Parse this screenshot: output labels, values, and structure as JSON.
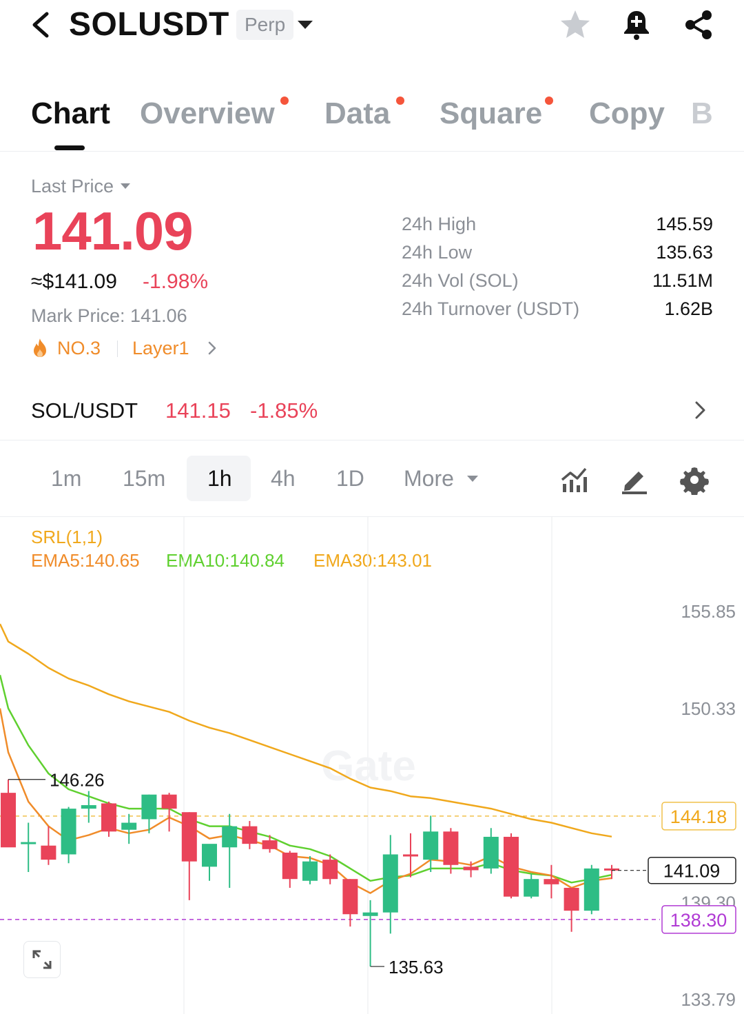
{
  "header": {
    "symbol": "SOLUSDT",
    "contract_type": "Perp",
    "icons": [
      "back-icon",
      "star-icon",
      "bell-plus-icon",
      "share-icon"
    ]
  },
  "tabs": [
    {
      "label": "Chart",
      "active": true,
      "dot": false
    },
    {
      "label": "Overview",
      "active": false,
      "dot": true
    },
    {
      "label": "Data",
      "active": false,
      "dot": true
    },
    {
      "label": "Square",
      "active": false,
      "dot": true
    },
    {
      "label": "Copy",
      "active": false,
      "dot": false
    },
    {
      "label": "B",
      "active": false,
      "dot": false
    }
  ],
  "price": {
    "last_price_label": "Last Price",
    "last_price": "141.09",
    "usd_price": "≈$141.09",
    "change_pct": "-1.98%",
    "mark_price_label": "Mark Price:",
    "mark_price": "141.06",
    "rank": "NO.3",
    "sector": "Layer1"
  },
  "stats": [
    {
      "label": "24h High",
      "value": "145.59"
    },
    {
      "label": "24h Low",
      "value": "135.63"
    },
    {
      "label": "24h Vol (SOL)",
      "value": "11.51M"
    },
    {
      "label": "24h Turnover (USDT)",
      "value": "1.62B"
    }
  ],
  "spot": {
    "pair": "SOL/USDT",
    "price": "141.15",
    "change_pct": "-1.85%"
  },
  "timeframes": {
    "options": [
      "1m",
      "15m",
      "1h",
      "4h",
      "1D"
    ],
    "active": "1h",
    "more_label": "More"
  },
  "indicators": {
    "srl": "SRL(1,1)",
    "ema5": "EMA5:140.65",
    "ema10": "EMA10:140.84",
    "ema30": "EMA30:143.01"
  },
  "colors": {
    "up": "#2ebd85",
    "down": "#e94359",
    "ema5": "#f08c2a",
    "ema10": "#5fd02f",
    "ema30": "#f0a81c",
    "mark_line": "#b03ad4"
  },
  "chart_data": {
    "type": "candlestick",
    "y_axis_labels": [
      "155.85",
      "150.33",
      "144.18",
      "141.09",
      "139.30",
      "138.30",
      "133.79"
    ],
    "current_price_label": "141.09",
    "reference_line_label": "144.18",
    "mark_line_label": "138.30",
    "high_marker": "146.26",
    "low_marker": "135.63",
    "watermark": "Gate",
    "candles": [
      {
        "o": 145.5,
        "h": 146.26,
        "l": 142.8,
        "c": 142.4
      },
      {
        "o": 142.7,
        "h": 143.8,
        "l": 141.0,
        "c": 142.7
      },
      {
        "o": 142.5,
        "h": 143.6,
        "l": 141.4,
        "c": 141.7
      },
      {
        "o": 142.0,
        "h": 144.7,
        "l": 141.5,
        "c": 144.6
      },
      {
        "o": 144.6,
        "h": 145.6,
        "l": 143.8,
        "c": 144.8
      },
      {
        "o": 144.9,
        "h": 145.0,
        "l": 143.0,
        "c": 143.3
      },
      {
        "o": 143.4,
        "h": 144.3,
        "l": 142.6,
        "c": 143.8
      },
      {
        "o": 144.0,
        "h": 145.4,
        "l": 143.2,
        "c": 145.4
      },
      {
        "o": 145.4,
        "h": 145.5,
        "l": 143.3,
        "c": 144.6
      },
      {
        "o": 144.4,
        "h": 144.4,
        "l": 139.4,
        "c": 141.6
      },
      {
        "o": 141.3,
        "h": 142.5,
        "l": 140.5,
        "c": 142.6
      },
      {
        "o": 142.4,
        "h": 144.3,
        "l": 140.1,
        "c": 143.6
      },
      {
        "o": 143.6,
        "h": 143.9,
        "l": 142.3,
        "c": 142.6
      },
      {
        "o": 142.8,
        "h": 143.1,
        "l": 142.1,
        "c": 142.3
      },
      {
        "o": 142.1,
        "h": 142.2,
        "l": 140.1,
        "c": 140.6
      },
      {
        "o": 140.5,
        "h": 141.9,
        "l": 140.3,
        "c": 141.6
      },
      {
        "o": 141.7,
        "h": 142.0,
        "l": 140.3,
        "c": 140.6
      },
      {
        "o": 140.6,
        "h": 140.6,
        "l": 137.9,
        "c": 138.6
      },
      {
        "o": 138.5,
        "h": 139.4,
        "l": 135.63,
        "c": 138.7
      },
      {
        "o": 138.7,
        "h": 143.1,
        "l": 137.5,
        "c": 142.0
      },
      {
        "o": 142.0,
        "h": 143.2,
        "l": 140.7,
        "c": 141.9
      },
      {
        "o": 141.7,
        "h": 144.2,
        "l": 141.0,
        "c": 143.3
      },
      {
        "o": 143.3,
        "h": 143.5,
        "l": 140.9,
        "c": 141.4
      },
      {
        "o": 141.3,
        "h": 141.6,
        "l": 140.7,
        "c": 141.1
      },
      {
        "o": 141.2,
        "h": 143.5,
        "l": 140.9,
        "c": 143.0
      },
      {
        "o": 143.0,
        "h": 143.2,
        "l": 139.5,
        "c": 139.6
      },
      {
        "o": 139.6,
        "h": 140.9,
        "l": 139.5,
        "c": 140.6
      },
      {
        "o": 140.6,
        "h": 141.4,
        "l": 139.5,
        "c": 140.3
      },
      {
        "o": 140.1,
        "h": 140.1,
        "l": 137.6,
        "c": 138.8
      },
      {
        "o": 138.8,
        "h": 141.4,
        "l": 138.6,
        "c": 141.2
      },
      {
        "o": 141.2,
        "h": 141.4,
        "l": 140.6,
        "c": 141.09
      }
    ],
    "ema5": [
      147.8,
      145.0,
      143.6,
      142.8,
      143.1,
      143.5,
      143.2,
      143.4,
      144.1,
      143.6,
      142.9,
      143.1,
      142.8,
      142.5,
      141.9,
      141.8,
      141.4,
      140.4,
      139.8,
      140.5,
      140.9,
      141.7,
      141.6,
      141.4,
      141.9,
      141.3,
      141.0,
      140.8,
      140.1,
      140.5,
      140.65
    ],
    "ema10": [
      150.3,
      148.2,
      146.6,
      145.7,
      145.3,
      144.9,
      144.6,
      144.6,
      144.6,
      144.0,
      143.6,
      143.6,
      143.3,
      143.0,
      142.5,
      142.3,
      141.9,
      141.2,
      140.5,
      140.7,
      140.8,
      141.2,
      141.2,
      141.2,
      141.5,
      141.1,
      140.9,
      140.8,
      140.4,
      140.6,
      140.84
    ],
    "ema30": [
      154.1,
      153.4,
      152.6,
      152.0,
      151.6,
      151.1,
      150.7,
      150.4,
      150.1,
      149.6,
      149.2,
      148.9,
      148.5,
      148.1,
      147.7,
      147.3,
      146.9,
      146.3,
      145.8,
      145.6,
      145.3,
      145.2,
      145.0,
      144.8,
      144.6,
      144.3,
      144.0,
      143.8,
      143.5,
      143.2,
      143.01
    ]
  }
}
